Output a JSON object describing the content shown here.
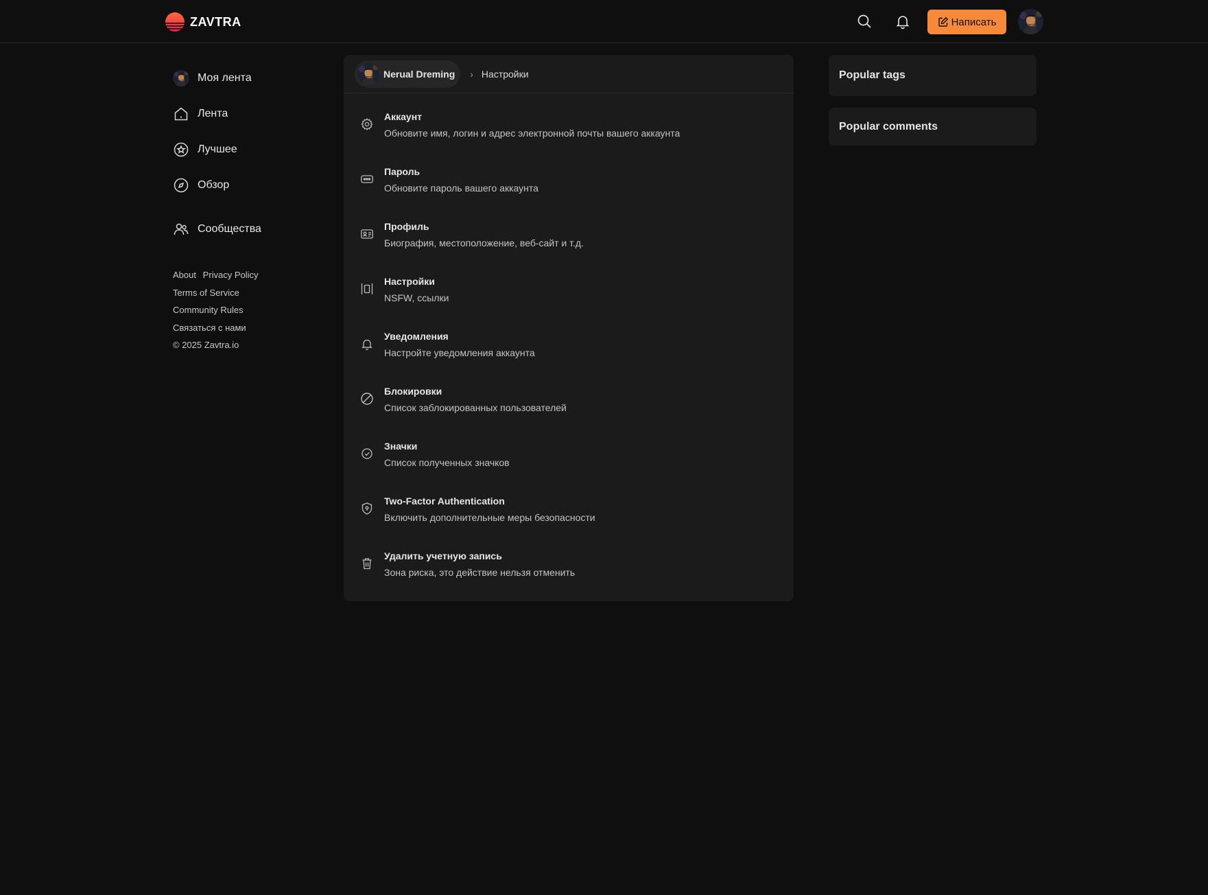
{
  "header": {
    "logo_text": "ZAVTRA",
    "write_button_label": "Написать",
    "accent_color": "#f7893a"
  },
  "sidebar": {
    "items": [
      {
        "label": "Моя лента",
        "icon": "user-avatar"
      },
      {
        "label": "Лента",
        "icon": "home-icon"
      },
      {
        "label": "Лучшее",
        "icon": "star-icon"
      },
      {
        "label": "Обзор",
        "icon": "compass-icon"
      },
      {
        "label": "Сообщества",
        "icon": "users-icon"
      }
    ],
    "footer": {
      "about": "About",
      "privacy": "Privacy Policy",
      "terms": "Terms of Service",
      "rules": "Community Rules",
      "contact": "Связаться с нами",
      "copyright": "© 2025 Zavtra.io"
    }
  },
  "breadcrumb": {
    "user_name": "Nerual Dreming",
    "separator": "›",
    "current": "Настройки"
  },
  "settings": [
    {
      "title": "Аккаунт",
      "description": "Обновите имя, логин и адрес электронной почты вашего аккаунта",
      "icon": "gear-icon"
    },
    {
      "title": "Пароль",
      "description": "Обновите пароль вашего аккаунта",
      "icon": "password-icon"
    },
    {
      "title": "Профиль",
      "description": "Биография, местоположение, веб-сайт и т.д.",
      "icon": "id-card-icon"
    },
    {
      "title": "Настройки",
      "description": "NSFW, ссылки",
      "icon": "columns-icon"
    },
    {
      "title": "Уведомления",
      "description": "Настройте уведомления аккаунта",
      "icon": "bell-icon"
    },
    {
      "title": "Блокировки",
      "description": "Список заблокированных пользователей",
      "icon": "block-icon"
    },
    {
      "title": "Значки",
      "description": "Список полученных значков",
      "icon": "badge-check-icon"
    },
    {
      "title": "Two-Factor Authentication",
      "description": "Включить дополнительные меры безопасности",
      "icon": "shield-icon"
    },
    {
      "title": "Удалить учетную запись",
      "description": "Зона риска, это действие нельзя отменить",
      "icon": "trash-icon"
    }
  ],
  "widgets": {
    "popular_tags": "Popular tags",
    "popular_comments": "Popular comments"
  }
}
